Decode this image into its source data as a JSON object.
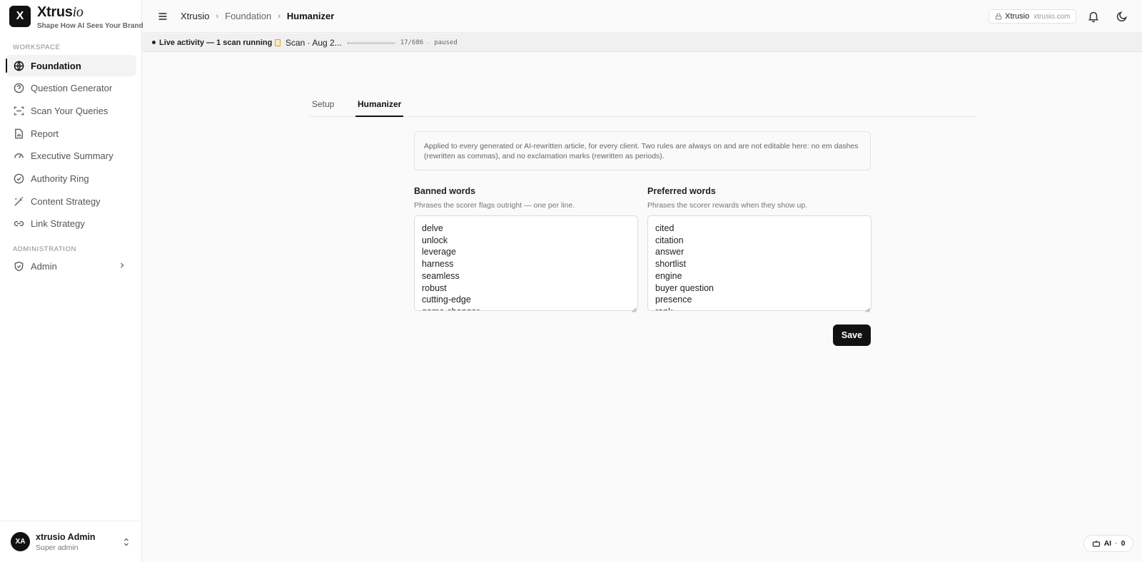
{
  "brand": {
    "logo_letter": "X",
    "name_main": "Xtrus",
    "name_italic": "io",
    "tagline": "Shape How AI Sees Your Brand"
  },
  "sidebar": {
    "workspace_label": "WORKSPACE",
    "items": [
      {
        "label": "Foundation",
        "icon": "globe-icon",
        "active": true
      },
      {
        "label": "Question Generator",
        "icon": "help-circle-icon"
      },
      {
        "label": "Scan Your Queries",
        "icon": "scan-icon"
      },
      {
        "label": "Report",
        "icon": "file-chart-icon"
      },
      {
        "label": "Executive Summary",
        "icon": "gauge-icon"
      },
      {
        "label": "Authority Ring",
        "icon": "check-circle-icon"
      },
      {
        "label": "Content Strategy",
        "icon": "magic-wand-icon"
      },
      {
        "label": "Link Strategy",
        "icon": "link-icon"
      }
    ],
    "admin_label": "ADMINISTRATION",
    "admin_item": {
      "label": "Admin",
      "icon": "shield-check-icon"
    }
  },
  "user": {
    "initials": "XA",
    "name": "xtrusio Admin",
    "role": "Super admin"
  },
  "header": {
    "breadcrumbs": [
      "Xtrusio",
      "Foundation",
      "Humanizer"
    ],
    "workspace_name": "Xtrusio",
    "workspace_domain": "xtrusio.com"
  },
  "activity": {
    "label": "Live activity — 1 scan running",
    "scan_name": "Scan · Aug 2...",
    "progress_done": 17,
    "progress_total": 686,
    "count_text": "17/686",
    "separator": "·",
    "status": "paused"
  },
  "tabs": [
    {
      "label": "Setup"
    },
    {
      "label": "Humanizer",
      "active": true
    }
  ],
  "info_text": "Applied to every generated or AI-rewritten article, for every client. Two rules are always on and are not editable here: no em dashes (rewritten as commas), and no exclamation marks (rewritten as periods).",
  "banned": {
    "title": "Banned words",
    "subtitle": "Phrases the scorer flags outright — one per line.",
    "value": "delve\nunlock\nleverage\nharness\nseamless\nrobust\ncutting-edge\ngame-changer"
  },
  "preferred": {
    "title": "Preferred words",
    "subtitle": "Phrases the scorer rewards when they show up.",
    "value": "cited\ncitation\nanswer\nshortlist\nengine\nbuyer question\npresence\nrank"
  },
  "save_label": "Save",
  "ai_pill": {
    "label": "AI",
    "separator": "·",
    "count": "0"
  }
}
